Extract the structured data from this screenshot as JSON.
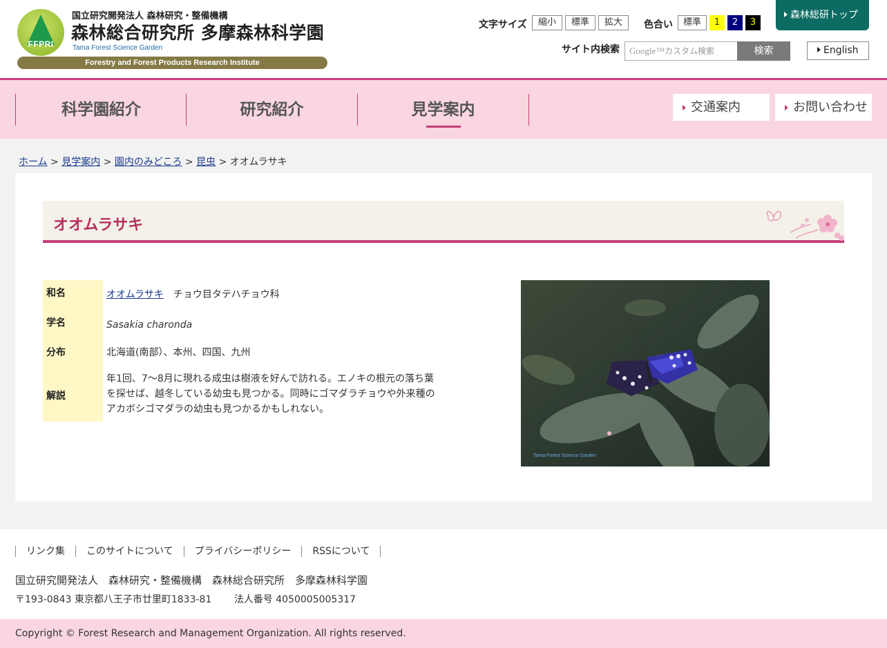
{
  "header": {
    "logo_mark": "FFPRI",
    "org_sub": "国立研究開発法人 森林研究・整備機構",
    "site_name": "森林総合研究所 多摩森林科学園",
    "site_name_en": "Tama Forest Science Garden",
    "institute_en": "Forestry and Forest Products Research Institute",
    "font_size_label": "文字サイズ",
    "font_sizes": [
      "縮小",
      "標準",
      "拡大"
    ],
    "color_label": "色合い",
    "colors": [
      {
        "label": "標準",
        "bg": "#ffffff",
        "fg": "#333333"
      },
      {
        "label": "1",
        "bg": "#ffff00",
        "fg": "#333333"
      },
      {
        "label": "2",
        "bg": "#000080",
        "fg": "#ffffff"
      },
      {
        "label": "3",
        "bg": "#000000",
        "fg": "#ffff00"
      }
    ],
    "top_link": "森林総研トップ",
    "search_label": "サイト内検索",
    "search_placeholder_brand": "Google™",
    "search_placeholder": "カスタム検索",
    "search_button": "検索",
    "english": "English"
  },
  "nav": {
    "items": [
      "科学園紹介",
      "研究紹介",
      "見学案内"
    ],
    "active": "見学案内",
    "access": "交通案内",
    "contact": "お問い合わせ"
  },
  "breadcrumb": {
    "links": [
      "ホーム",
      "見学案内",
      "園内のみどころ",
      "昆虫"
    ],
    "separator": ">",
    "current": "オオムラサキ"
  },
  "page": {
    "title": "オオムラサキ",
    "rows": {
      "wamei_label": "和名",
      "wamei_link": "オオムラサキ",
      "wamei_extra": "チョウ目タテハチョウ科",
      "gakumei_label": "学名",
      "gakumei": "Sasakia charonda",
      "bunpu_label": "分布",
      "bunpu": "北海道(南部）、本州、四国、九州",
      "kaisetsu_label": "解説",
      "kaisetsu": "年1回、7～8月に現れる成虫は樹液を好んで訪れる。エノキの根元の落ち葉を探せば、越冬している幼虫も見つかる。同時にゴマダラチョウや外来種のアカボシゴマダラの幼虫も見つかるかもしれない。"
    },
    "photo_caption": "Tama Forest Science Garden"
  },
  "footer": {
    "links": [
      "リンク集",
      "このサイトについて",
      "プライバシーポリシー",
      "RSSについて"
    ],
    "org": "国立研究開発法人　森林研究・整備機構　森林総合研究所　多摩森林科学園",
    "address": "〒193-0843 東京都八王子市廿里町1833-81",
    "corp_no": "法人番号 4050005005317",
    "copyright": "Copyright © Forest Research and Management Organization. All rights reserved."
  },
  "theme": {
    "accent": "#c33d78",
    "nav_bg": "#f9d6e0",
    "top_link_bg": "#0c6b62",
    "label_bg": "#fff7c6"
  }
}
